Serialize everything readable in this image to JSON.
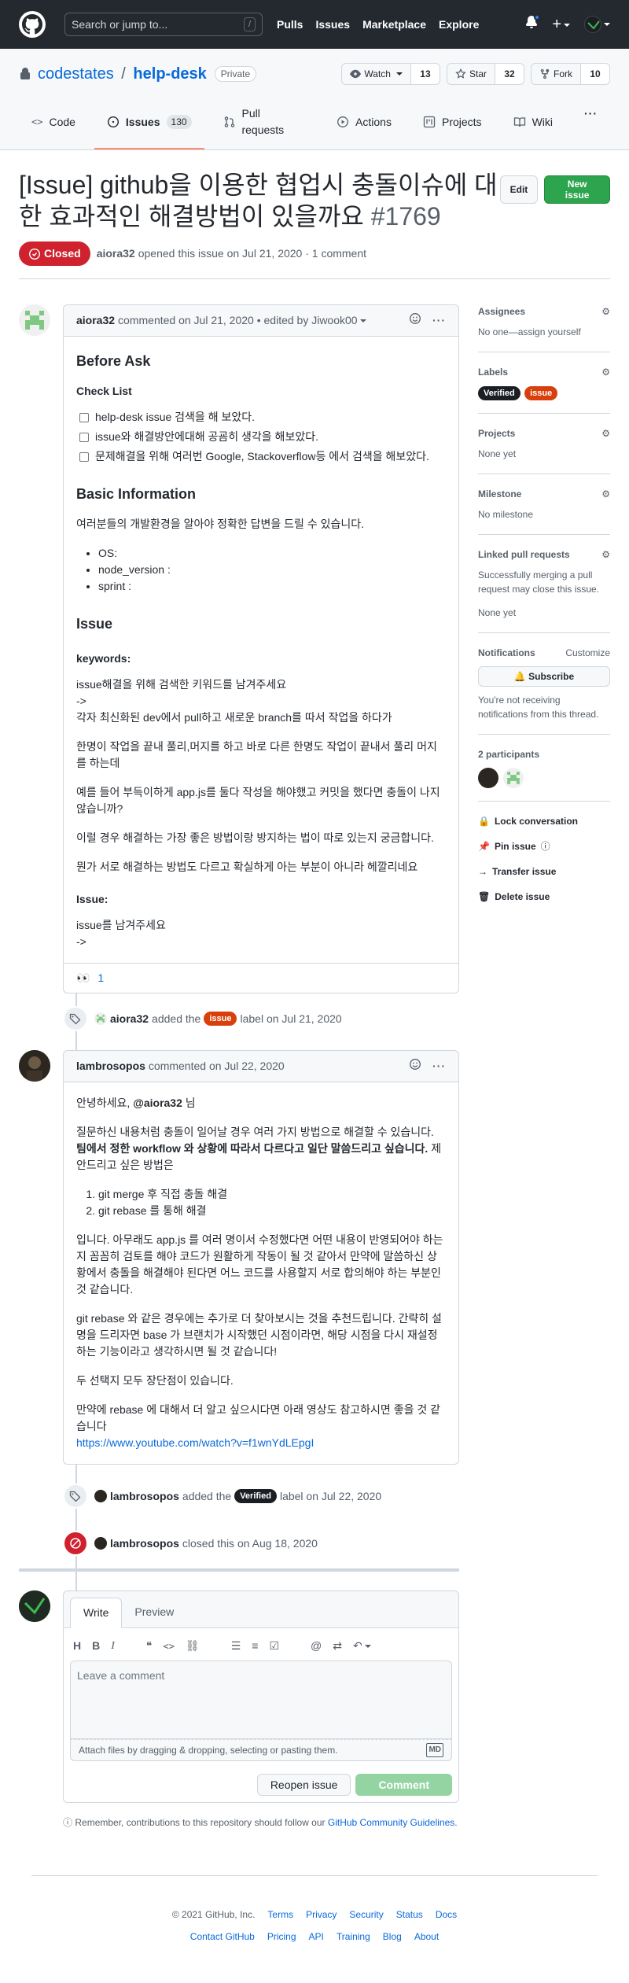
{
  "header": {
    "search_placeholder": "Search or jump to...",
    "search_shortcut": "/",
    "nav": [
      "Pulls",
      "Issues",
      "Marketplace",
      "Explore"
    ]
  },
  "repo": {
    "owner": "codestates",
    "separator": "/",
    "name": "help-desk",
    "visibility": "Private",
    "watch_label": "Watch",
    "watch_count": "13",
    "star_label": "Star",
    "star_count": "32",
    "fork_label": "Fork",
    "fork_count": "10"
  },
  "tabs": [
    {
      "label": "Code"
    },
    {
      "label": "Issues",
      "count": "130"
    },
    {
      "label": "Pull requests"
    },
    {
      "label": "Actions"
    },
    {
      "label": "Projects"
    },
    {
      "label": "Wiki"
    }
  ],
  "issue": {
    "title": "[Issue] github을 이용한 협업시 충돌이슈에 대한 효과적인 해결방법이 있을까요",
    "number": "#1769",
    "edit_label": "Edit",
    "new_issue_label": "New issue",
    "state": "Closed",
    "author": "aiora32",
    "meta_text": "opened this issue on Jul 21, 2020 · 1 comment"
  },
  "comment1": {
    "author": "aiora32",
    "meta": "commented on Jul 21, 2020 • edited by Jiwook00",
    "h_before_ask": "Before Ask",
    "h_check_list": "Check List",
    "checklist": [
      "help-desk issue 검색을 해 보았다.",
      "issue와 해결방안에대해 공굠히 생각을 해보았다.",
      "문제해결을 위해 여러번 Google, Stackoverflow등 에서 검색을 해보았다."
    ],
    "h_basic_info": "Basic Information",
    "basic_info_text": "여러분들의 개발환경을 알아야 정확한 답변을 드릴 수 있습니다.",
    "basic_list": [
      "OS:",
      "node_version :",
      "sprint :"
    ],
    "h_issue": "Issue",
    "keywords_label": "keywords:",
    "p1_a": "issue해결을 위해 검색한 키워드를 남겨주세요",
    "p1_b": "->",
    "p1_c": "각자 최신화된 dev에서 pull하고 새로운 branch를 따서 작업을 하다가",
    "p2": "한명이 작업을 끝내 풀리,머지를 하고 바로 다른 한명도 작업이 끝내서 풀리 머지를 하는데",
    "p3": "예를 들어 부득이하게 app.js를 둘다 작성을 해야했고 커밋을 했다면 충돌이 나지않습니까?",
    "p4": "이럴 경우 해결하는 가장 좋은 방법이랑 방지하는 법이 따로 있는지 궁금합니다.",
    "p5": "뭔가 서로 해결하는 방법도 다르고 확실하게 아는 부분이 아니라 헤깔리네요",
    "issue_label": "Issue:",
    "p6_a": "issue를 남겨주세요",
    "p6_b": "->",
    "reaction_emoji": "👀",
    "reaction_count": "1"
  },
  "event1": {
    "actor": "aiora32",
    "text_a": "added the",
    "label": "issue",
    "text_b": "label on Jul 21, 2020"
  },
  "comment2": {
    "author": "lambrosopos",
    "meta": "commented on Jul 22, 2020",
    "greeting_a": "안녕하세요,",
    "greeting_mention": "@aiora32",
    "greeting_b": "님",
    "p1_a": "질문하신 내용처럼 충돌이 일어날 경우 여러 가지 방법으로 해결할 수 있습니다.",
    "p1_bold": "팀에서 정한 workflow 와 상황에 따라서 다르다고 일단 말씀드리고 싶습니다.",
    "p1_b": "제안드리고 싶은 방법은",
    "ol": [
      "git merge 후 직접 충돌 해결",
      "git rebase 를 통해 해결"
    ],
    "p2": "입니다. 아무래도 app.js 를 여러 명이서 수정했다면 어떤 내용이 반영되어야 하는지 꼼꼼히 검토를 해야 코드가 원활하게 작동이 될 것 같아서 만약에 말씀하신 상황에서 충돌을 해결해야 된다면 어느 코드를 사용할지 서로 합의해야 하는 부분인 것 같습니다.",
    "p3": "git rebase 와 같은 경우에는 추가로 더 찾아보시는 것을 추천드립니다. 간략히 설명을 드리자면 base 가 브랜치가 시작했던 시점이라면, 해당 시점을 다시 재설정하는 기능이라고 생각하시면 될 것 같습니다!",
    "p4": "두 선택지 모두 장단점이 있습니다.",
    "p5": "만약에 rebase 에 대해서 더 알고 싶으시다면 아래 영상도 참고하시면 좋을 것 같습니다",
    "link": "https://www.youtube.com/watch?v=f1wnYdLEpgI"
  },
  "event2": {
    "actor": "lambrosopos",
    "text_a": "added the",
    "label": "Verified",
    "text_b": "label on Jul 22, 2020"
  },
  "event3": {
    "actor": "lambrosopos",
    "text": "closed this on Aug 18, 2020"
  },
  "new_comment": {
    "tab_write": "Write",
    "tab_preview": "Preview",
    "placeholder": "Leave a comment",
    "attach_text": "Attach files by dragging & dropping, selecting or pasting them.",
    "md_badge": "MD",
    "reopen_label": "Reopen issue",
    "comment_label": "Comment",
    "remember_a": "Remember, contributions to this repository should follow our",
    "remember_link": "GitHub Community Guidelines",
    "remember_b": "."
  },
  "sidebar": {
    "assignees_title": "Assignees",
    "assignees_value": "No one—assign yourself",
    "labels_title": "Labels",
    "labels": [
      {
        "name": "Verified",
        "bg": "#1b1f24",
        "fg": "#ffffff"
      },
      {
        "name": "issue",
        "bg": "#d93f0b",
        "fg": "#ffffff"
      }
    ],
    "projects_title": "Projects",
    "projects_value": "None yet",
    "milestone_title": "Milestone",
    "milestone_value": "No milestone",
    "linked_title": "Linked pull requests",
    "linked_desc": "Successfully merging a pull request may close this issue.",
    "linked_value": "None yet",
    "notifications_title": "Notifications",
    "customize": "Customize",
    "subscribe": "Subscribe",
    "notif_desc": "You're not receiving notifications from this thread.",
    "participants_title": "2 participants",
    "lock": "Lock conversation",
    "pin": "Pin issue",
    "transfer": "Transfer issue",
    "delete": "Delete issue"
  },
  "footer": {
    "copyright": "© 2021 GitHub, Inc.",
    "row1": [
      "Terms",
      "Privacy",
      "Security",
      "Status",
      "Docs"
    ],
    "row2": [
      "Contact GitHub",
      "Pricing",
      "API",
      "Training",
      "Blog",
      "About"
    ]
  },
  "colors": {
    "header_bg": "#24292f",
    "closed_red": "#cf222e",
    "green": "#2da44e",
    "link": "#0969da"
  }
}
